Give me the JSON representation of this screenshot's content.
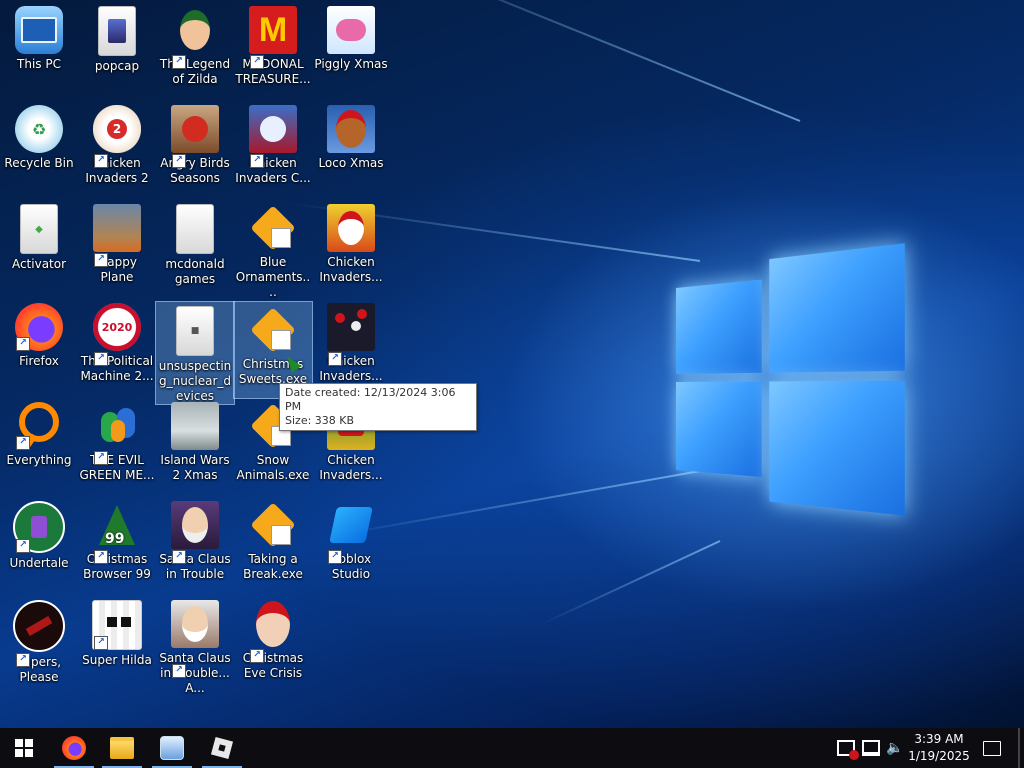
{
  "desktop": {
    "icons": [
      {
        "label": "This PC"
      },
      {
        "label": "popcap"
      },
      {
        "label": "The Legend of Zilda"
      },
      {
        "label": "MCDONAL TREASURE..."
      },
      {
        "label": "Piggly Xmas"
      },
      {
        "label": "Recycle Bin"
      },
      {
        "label": "Chicken Invaders 2"
      },
      {
        "label": "Angry Birds Seasons"
      },
      {
        "label": "Chicken Invaders C..."
      },
      {
        "label": "Loco Xmas"
      },
      {
        "label": "Activator"
      },
      {
        "label": "Flappy Plane"
      },
      {
        "label": "mcdonald games"
      },
      {
        "label": "Blue Ornaments...."
      },
      {
        "label": "Chicken Invaders..."
      },
      {
        "label": "Firefox"
      },
      {
        "label": "The Political Machine 2..."
      },
      {
        "label": "unsuspecting_nuclear_devices"
      },
      {
        "label": "Christmas Sweets.exe"
      },
      {
        "label": "Chicken Invaders..."
      },
      {
        "label": "Everything"
      },
      {
        "label": "THE EVIL GREEN ME..."
      },
      {
        "label": "Island Wars 2 Xmas"
      },
      {
        "label": "Snow Animals.exe"
      },
      {
        "label": "Chicken Invaders..."
      },
      {
        "label": "Undertale"
      },
      {
        "label": "Christmas Browser 99"
      },
      {
        "label": "Santa Claus in Trouble"
      },
      {
        "label": "Taking a Break.exe"
      },
      {
        "label": "Roblox Studio"
      },
      {
        "label": "Papers, Please"
      },
      {
        "label": "Super Hilda"
      },
      {
        "label": "Santa Claus in Trouble... A..."
      },
      {
        "label": "Christmas Eve Crisis"
      }
    ],
    "icon_text": {
      "political_badge": "2020",
      "browser_badge": "99",
      "mcd_glyph": "M"
    }
  },
  "tooltip": {
    "line1": "Date created: 12/13/2024 3:06 PM",
    "line2": "Size: 338 KB"
  },
  "taskbar": {
    "time": "3:39 AM",
    "date": "1/19/2025",
    "icons": [
      "windows-start-icon",
      "firefox-icon",
      "file-explorer-icon",
      "xmas-app-icon",
      "roblox-icon",
      "security-alert-icon",
      "network-icon",
      "volume-icon",
      "notifications-icon"
    ]
  },
  "colors": {
    "accent": "#7eb4ea",
    "taskbar": "#0d0d11",
    "selection": "#82b4e6"
  }
}
